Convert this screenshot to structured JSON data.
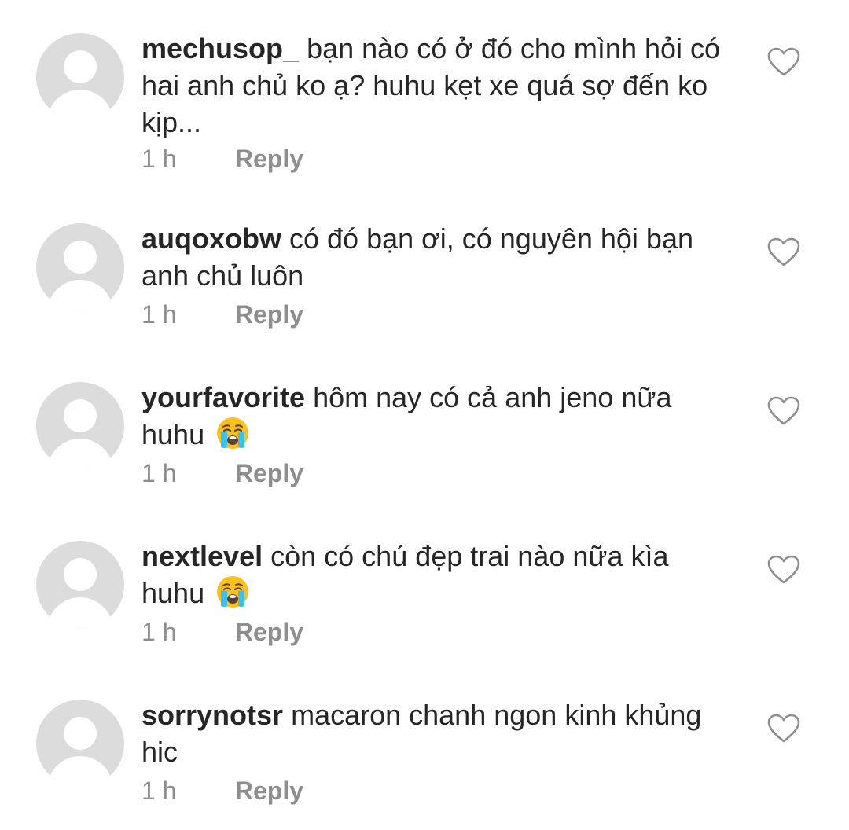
{
  "comments": [
    {
      "username": "mechusop_",
      "text": "bạn nào có ở đó cho mình hỏi có hai anh chủ ko ạ? huhu kẹt xe quá sợ đến ko kịp...",
      "time": "1 h",
      "reply_label": "Reply",
      "emoji": ""
    },
    {
      "username": "auqoxobw",
      "text": "có đó bạn ơi, có nguyên hội bạn anh chủ luôn",
      "time": "1 h",
      "reply_label": "Reply",
      "emoji": ""
    },
    {
      "username": "yourfavorite",
      "text": "hôm nay có cả anh jeno nữa huhu",
      "time": "1 h",
      "reply_label": "Reply",
      "emoji": "loudly-crying-face"
    },
    {
      "username": "nextlevel",
      "text": "còn có chú đẹp trai nào nữa kìa huhu",
      "time": "1 h",
      "reply_label": "Reply",
      "emoji": "loudly-crying-face"
    },
    {
      "username": "sorrynotsr",
      "text": "macaron chanh ngon kinh khủng hic",
      "time": "1 h",
      "reply_label": "Reply",
      "emoji": ""
    }
  ],
  "icons": {
    "avatar": "default-avatar-icon",
    "like": "heart-outline-icon",
    "emoji": "loudly-crying-face-icon"
  },
  "colors": {
    "text": "#262626",
    "meta": "#8e8e8e",
    "avatar_bg": "#dcdcdc",
    "background": "#ffffff"
  }
}
